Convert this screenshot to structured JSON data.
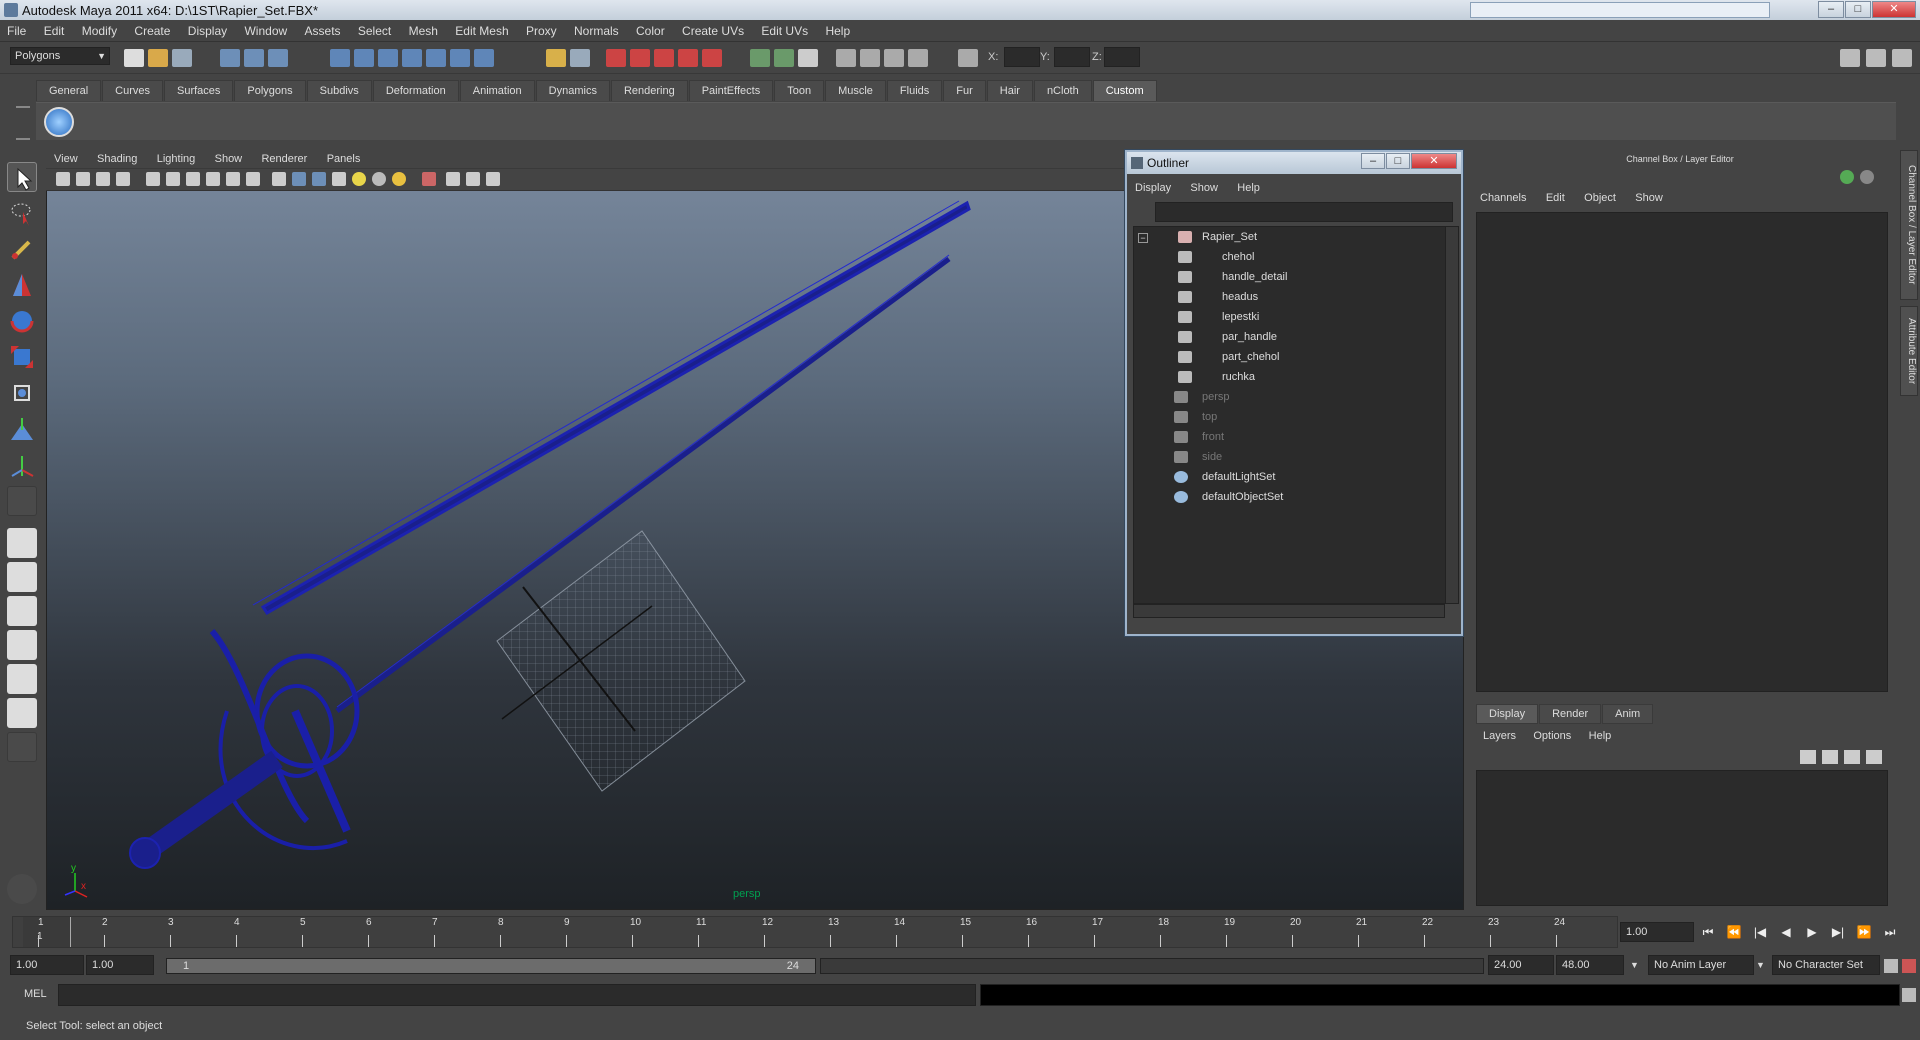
{
  "window": {
    "title": "Autodesk Maya 2011 x64: D:\\1ST\\Rapier_Set.FBX*"
  },
  "menu": [
    "File",
    "Edit",
    "Modify",
    "Create",
    "Display",
    "Window",
    "Assets",
    "Select",
    "Mesh",
    "Edit Mesh",
    "Proxy",
    "Normals",
    "Color",
    "Create UVs",
    "Edit UVs",
    "Help"
  ],
  "toolbar": {
    "mode": "Polygons",
    "x_label": "X:",
    "y_label": "Y:",
    "z_label": "Z:"
  },
  "shelf_tabs": [
    "General",
    "Curves",
    "Surfaces",
    "Polygons",
    "Subdivs",
    "Deformation",
    "Animation",
    "Dynamics",
    "Rendering",
    "PaintEffects",
    "Toon",
    "Muscle",
    "Fluids",
    "Fur",
    "Hair",
    "nCloth",
    "Custom"
  ],
  "shelf_active": "Custom",
  "viewport": {
    "menu": [
      "View",
      "Shading",
      "Lighting",
      "Show",
      "Renderer",
      "Panels"
    ],
    "camera_label": "persp",
    "axis": {
      "y": "y",
      "x": "x"
    }
  },
  "outliner": {
    "title": "Outliner",
    "menu": [
      "Display",
      "Show",
      "Help"
    ],
    "items": [
      {
        "label": "Rapier_Set",
        "level": 0,
        "dim": false
      },
      {
        "label": "chehol",
        "level": 1,
        "dim": false
      },
      {
        "label": "handle_detail",
        "level": 1,
        "dim": false
      },
      {
        "label": "headus",
        "level": 1,
        "dim": false
      },
      {
        "label": "lepestki",
        "level": 1,
        "dim": false
      },
      {
        "label": "par_handle",
        "level": 1,
        "dim": false
      },
      {
        "label": "part_chehol",
        "level": 1,
        "dim": false
      },
      {
        "label": "ruchka",
        "level": 1,
        "dim": false
      },
      {
        "label": "persp",
        "level": 0,
        "dim": true
      },
      {
        "label": "top",
        "level": 0,
        "dim": true
      },
      {
        "label": "front",
        "level": 0,
        "dim": true
      },
      {
        "label": "side",
        "level": 0,
        "dim": true
      },
      {
        "label": "defaultLightSet",
        "level": 0,
        "dim": false
      },
      {
        "label": "defaultObjectSet",
        "level": 0,
        "dim": false
      }
    ]
  },
  "channel_box": {
    "title": "Channel Box / Layer Editor",
    "menu": [
      "Channels",
      "Edit",
      "Object",
      "Show"
    ],
    "layer_tabs": [
      "Display",
      "Render",
      "Anim"
    ],
    "layer_active": "Display",
    "layer_menu": [
      "Layers",
      "Options",
      "Help"
    ],
    "side_tabs": [
      "Channel Box / Layer Editor",
      "Attribute Editor"
    ]
  },
  "timeline": {
    "ticks": [
      "1",
      "2",
      "3",
      "4",
      "5",
      "6",
      "7",
      "8",
      "9",
      "10",
      "11",
      "12",
      "13",
      "14",
      "15",
      "16",
      "17",
      "18",
      "19",
      "20",
      "21",
      "22",
      "23",
      "24"
    ],
    "current_frame_marker": "1",
    "current_frame": "1.00"
  },
  "range": {
    "start_outer": "1.00",
    "start_inner": "1.00",
    "slider_start": "1",
    "slider_end": "24",
    "end_inner": "24.00",
    "end_outer": "48.00",
    "anim_layer": "No Anim Layer",
    "char_set": "No Character Set"
  },
  "command": {
    "label": "MEL"
  },
  "status": {
    "text": "Select Tool: select an object"
  }
}
